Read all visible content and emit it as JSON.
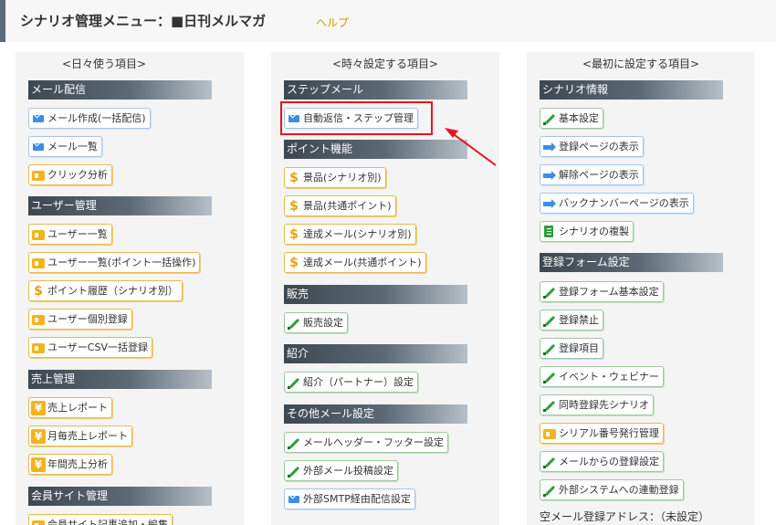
{
  "header": {
    "title": "シナリオ管理メニュー：■日刊メルマガ",
    "help": "ヘルプ"
  },
  "col1": {
    "heading": "<日々使う項目>",
    "sections": {
      "mail": "メール配信",
      "user": "ユーザー管理",
      "sales": "売上管理",
      "member": "会員サイト管理"
    },
    "items": {
      "mail_create": "メール作成(一括配信)",
      "mail_list": "メール一覧",
      "click": "クリック分析",
      "user_list": "ユーザー一覧",
      "user_list_point": "ユーザー一覧(ポイント一括操作)",
      "point_history": "ポイント履歴（シナリオ別）",
      "user_register": "ユーザー個別登録",
      "user_csv": "ユーザーCSV一括登録",
      "sales_report": "売上レポート",
      "monthly_report": "月毎売上レポート",
      "yearly_report": "年間売上分析",
      "member_item": "会員サイト記事追加・編集"
    }
  },
  "col2": {
    "heading": "<時々設定する項目>",
    "sections": {
      "step": "ステップメール",
      "point": "ポイント機能",
      "sell": "販売",
      "intro": "紹介",
      "other": "その他メール設定"
    },
    "items": {
      "auto_reply": "自動返信・ステップ管理",
      "prize_scenario": "景品(シナリオ別)",
      "prize_common": "景品(共通ポイント)",
      "achieve_scenario": "達成メール(シナリオ別)",
      "achieve_common": "達成メール(共通ポイント)",
      "sales_setting": "販売設定",
      "partner": "紹介（パートナー）設定",
      "header_footer": "メールヘッダー・フッター設定",
      "external_post": "外部メール投稿設定",
      "smtp": "外部SMTP経由配信設定"
    }
  },
  "col3": {
    "heading": "<最初に設定する項目>",
    "sections": {
      "scenario": "シナリオ情報",
      "form": "登録フォーム設定"
    },
    "items": {
      "basic": "基本設定",
      "reg_page": "登録ページの表示",
      "unreg_page": "解除ページの表示",
      "backnumber": "バックナンバーページの表示",
      "copy": "シナリオの複製",
      "form_basic": "登録フォーム基本設定",
      "ban": "登録禁止",
      "fields": "登録項目",
      "event": "イベント・ウェビナー",
      "simul": "同時登録先シナリオ",
      "serial": "シリアル番号発行管理",
      "mail_reg": "メールからの登録設定",
      "ext_sys": "外部システムへの連動登録",
      "empty_mail": "空メール登録アドレス：（未設定）"
    }
  },
  "colors": {
    "highlight": "#e8141b",
    "help": "#c9a000",
    "section_dark": "#3d4750"
  }
}
